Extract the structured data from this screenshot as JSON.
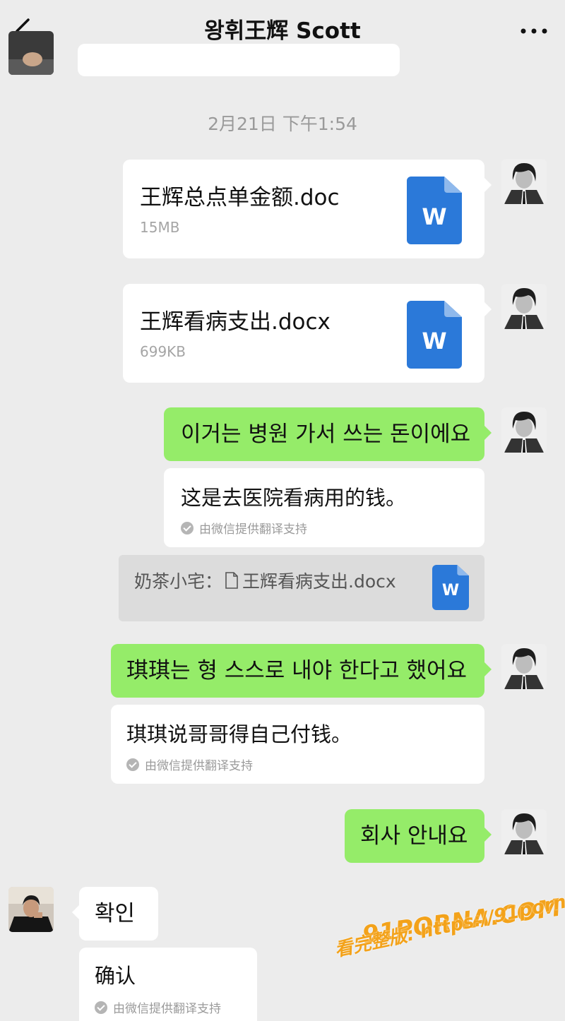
{
  "header": {
    "title": "왕휘王辉 Scott"
  },
  "timestamp": "2月21日 下午1:54",
  "files": [
    {
      "name": "王辉总点单金额.doc",
      "size": "15MB",
      "icon_letter": "W"
    },
    {
      "name": "王辉看病支出.docx",
      "size": "699KB",
      "icon_letter": "W"
    }
  ],
  "messages": [
    {
      "text": "이거는 병원 가서 쓰는 돈이에요",
      "translation": "这是去医院看病用的钱。",
      "note": "由微信提供翻译支持"
    },
    {
      "text": "琪琪는 형 스스로 내야 한다고 했어요",
      "translation": "琪琪说哥哥得自己付钱。",
      "note": "由微信提供翻译支持"
    },
    {
      "text": "회사 안내요"
    },
    {
      "text": "확인",
      "translation": "确认",
      "note": "由微信提供翻译支持"
    }
  ],
  "quote": {
    "prefix": "奶茶小宅：",
    "file": "王辉看病支出.docx",
    "icon_letter": "W"
  },
  "watermark": {
    "logo": "91PORNA.COM",
    "url": "看完整版: https://91porna73.com"
  },
  "colors": {
    "background": "#ececec",
    "sent_bubble": "#95ec69",
    "received_bubble": "#ffffff",
    "doc_icon": "#2b79d9",
    "watermark": "#f3a21a"
  }
}
